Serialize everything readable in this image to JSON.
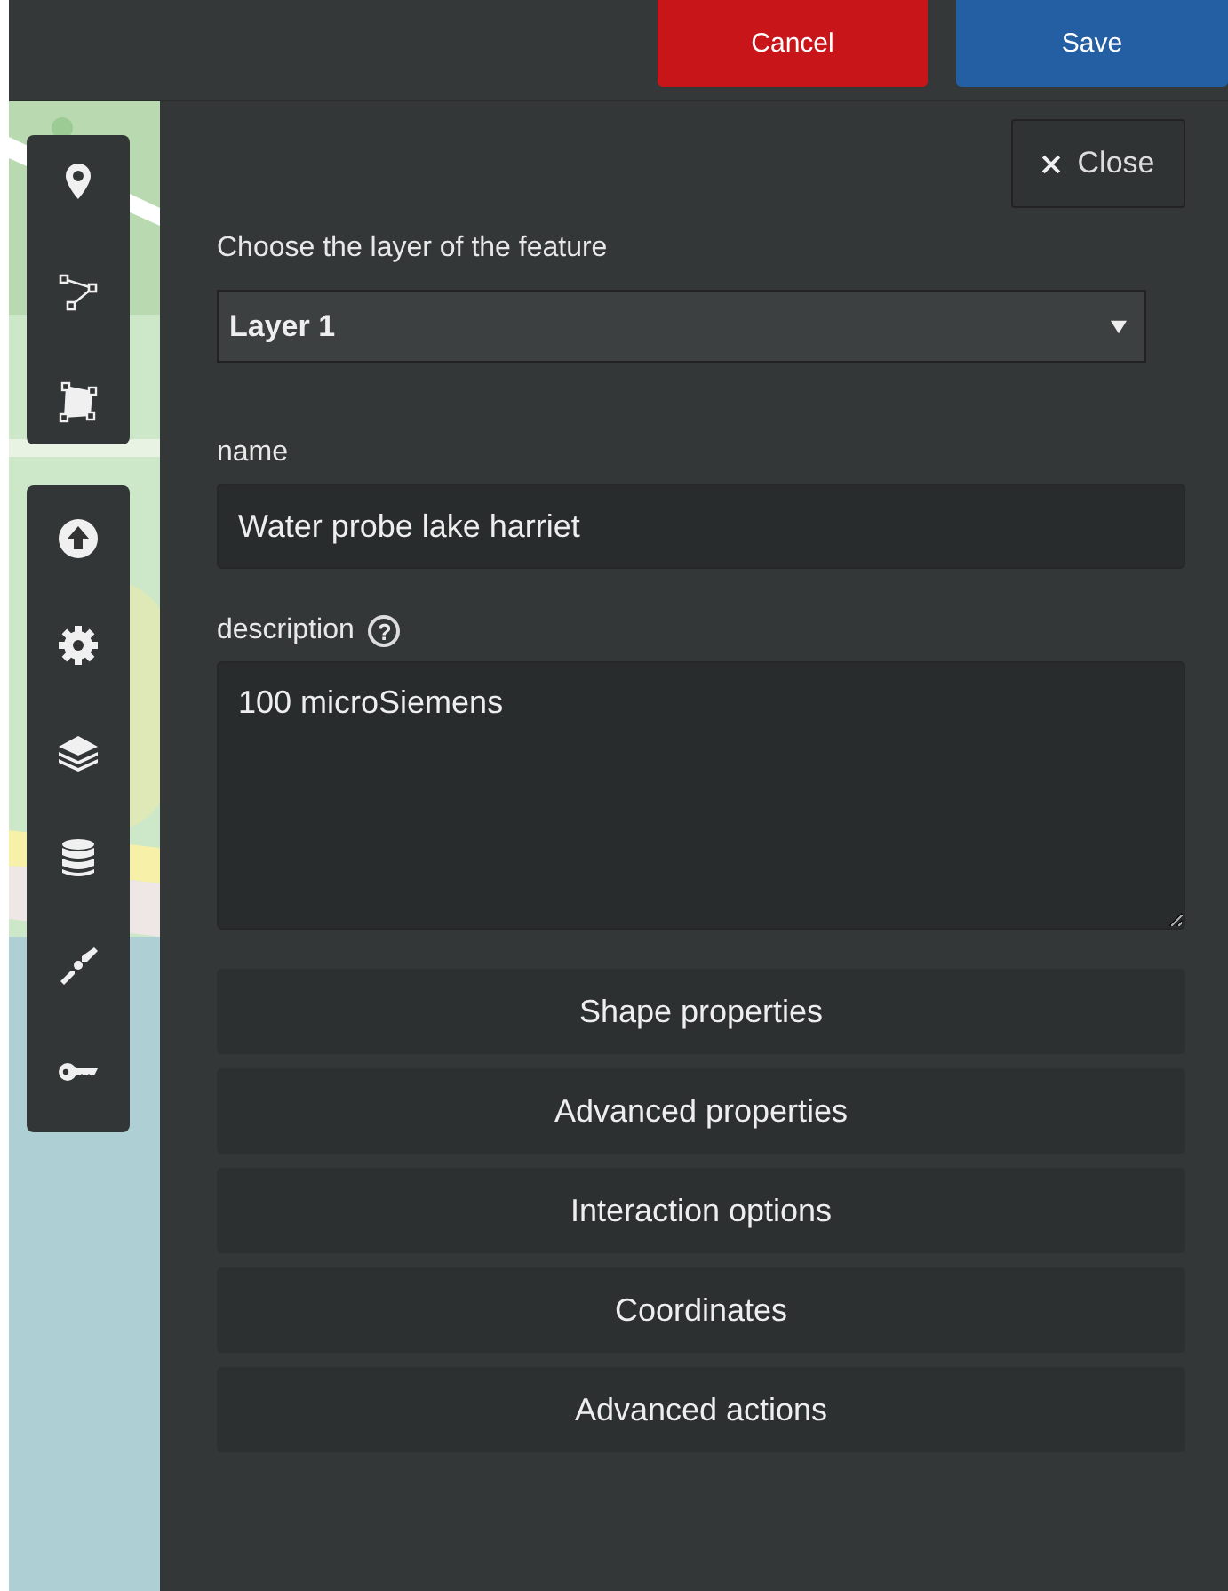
{
  "header": {
    "buttons": [
      {
        "label": "Cancel",
        "kind": "cancel"
      },
      {
        "label": "Save",
        "kind": "save"
      }
    ]
  },
  "panel": {
    "close": {
      "label": "Close"
    },
    "layer": {
      "label": "Choose the layer of the feature",
      "value": "Layer 1"
    },
    "name": {
      "label": "name",
      "value": "Water probe lake harriet"
    },
    "description": {
      "label": "description",
      "help": "?",
      "value": "100 microSiemens"
    },
    "sections": [
      "Shape properties",
      "Advanced properties",
      "Interaction options",
      "Coordinates",
      "Advanced actions"
    ]
  }
}
